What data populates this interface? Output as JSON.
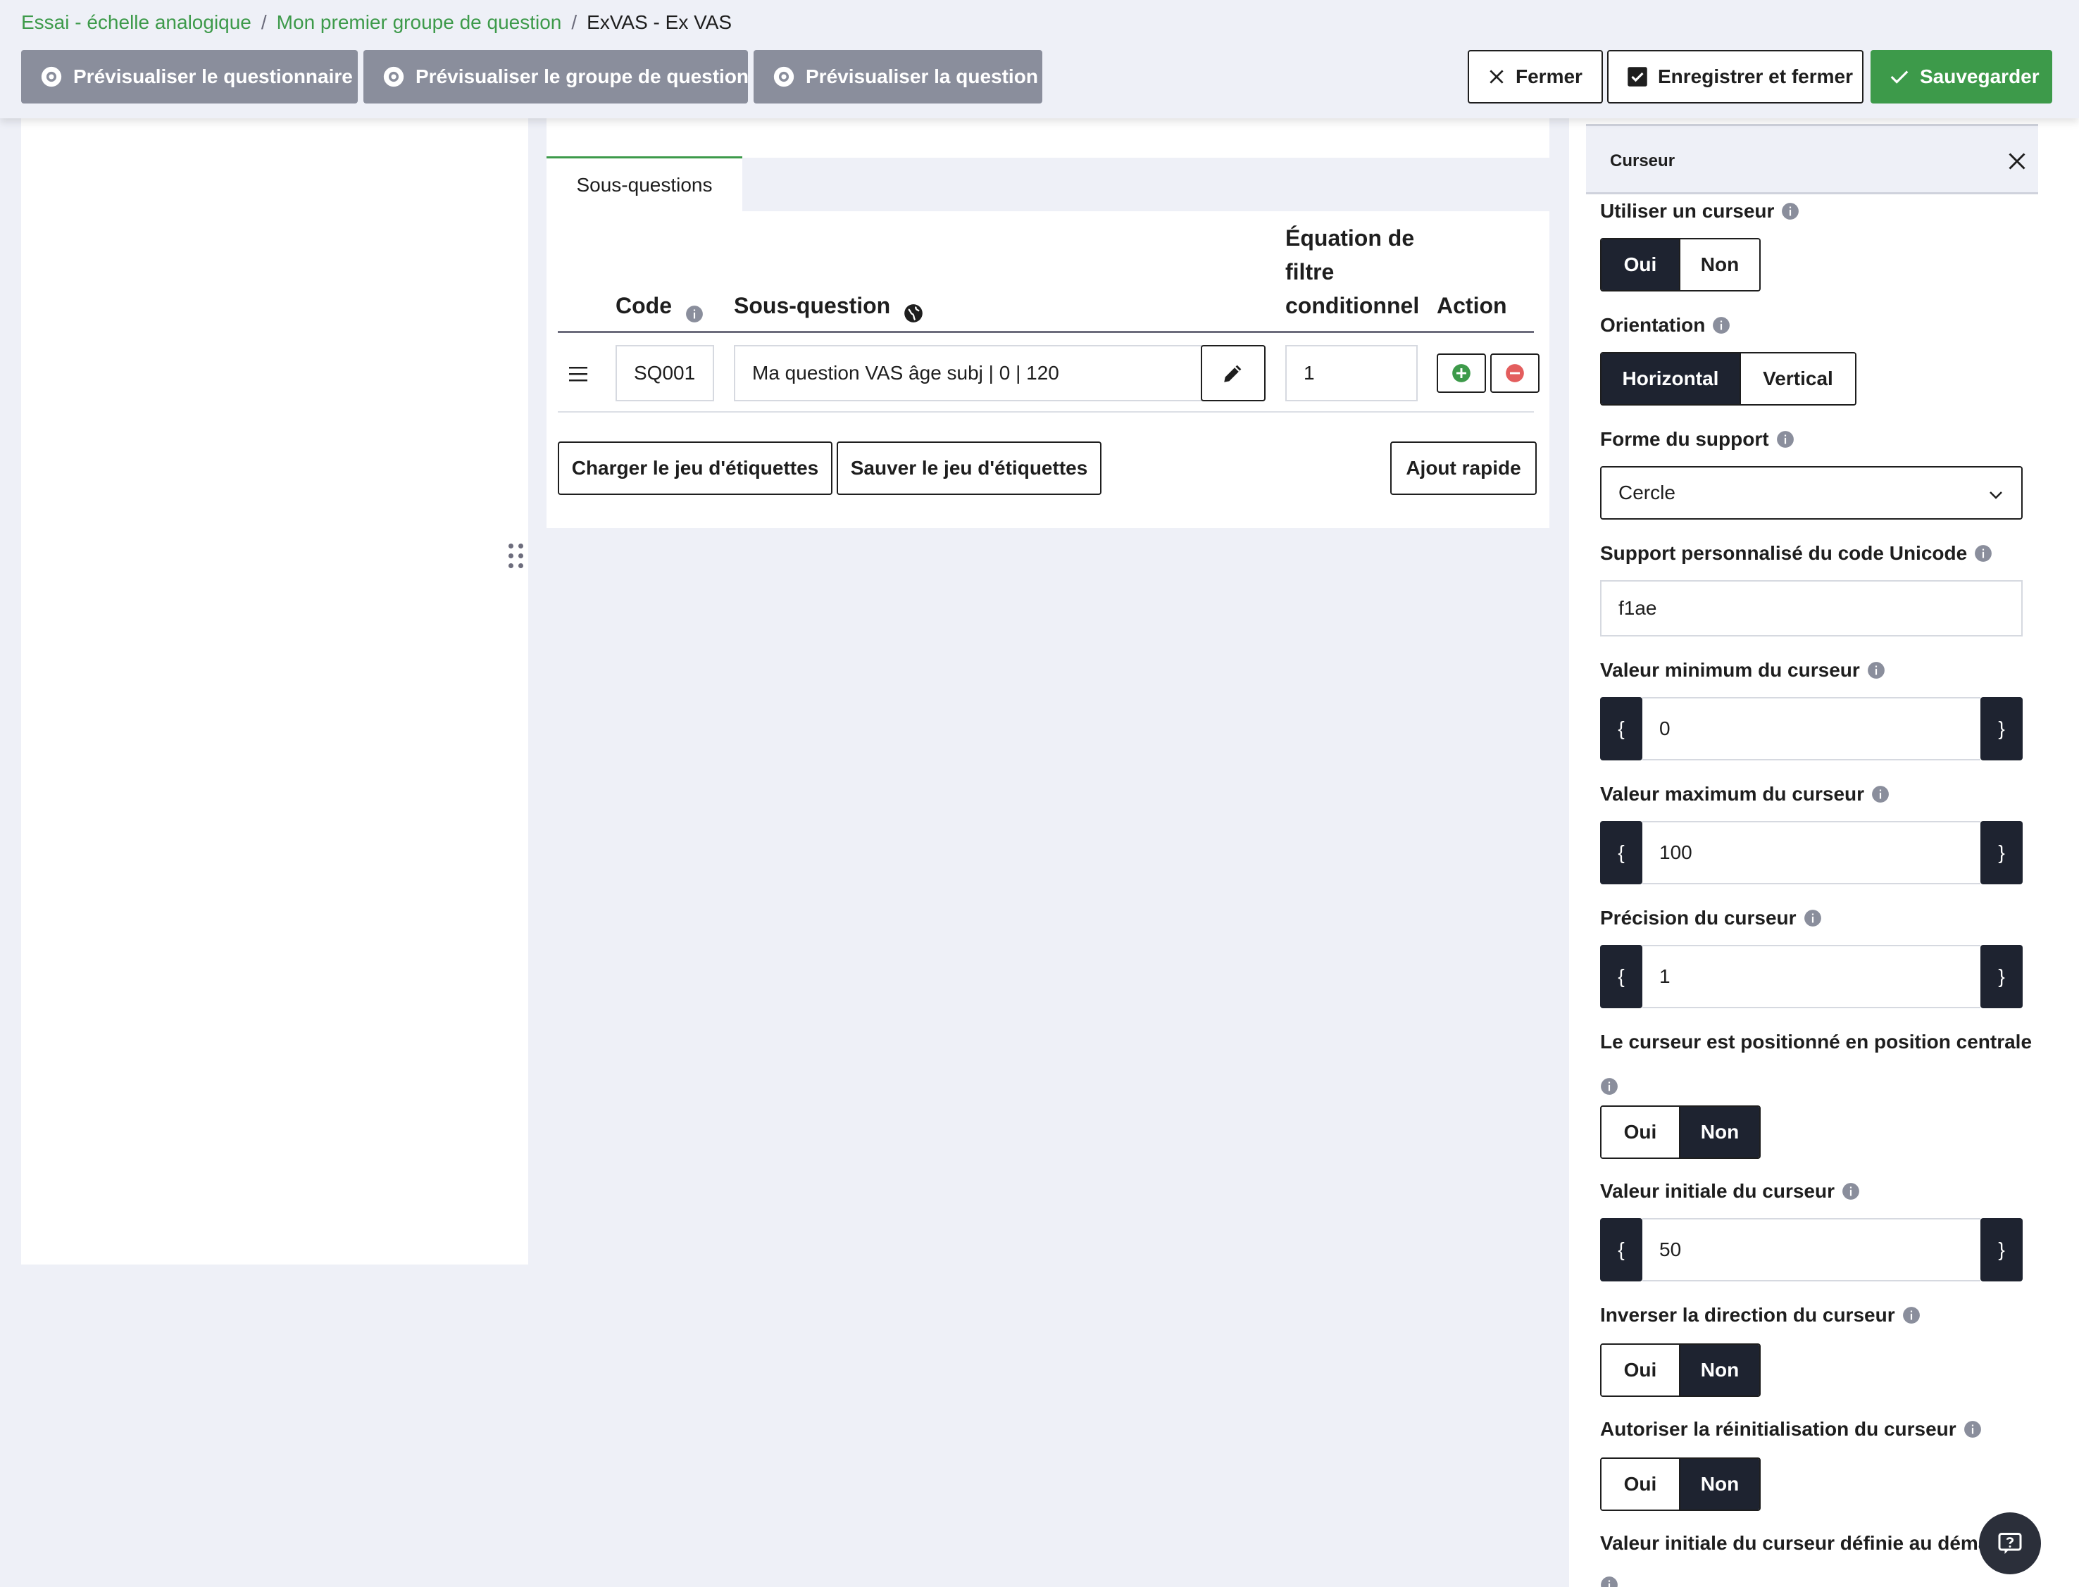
{
  "breadcrumb": {
    "survey": "Essai - échelle analogique",
    "group": "Mon premier groupe de question",
    "current": "ExVAS - Ex VAS",
    "separator": "/"
  },
  "toolbar": {
    "preview_survey": "Prévisualiser le questionnaire",
    "preview_group": "Prévisualiser le groupe de question",
    "preview_question": "Prévisualiser la question",
    "close": "Fermer",
    "save_close": "Enregistrer et fermer",
    "save": "Sauvegarder"
  },
  "center": {
    "tab_label": "Sous-questions",
    "table": {
      "headers": {
        "code": "Code",
        "subquestion": "Sous-question",
        "equation_l1": "Équation de",
        "equation_l2": "filtre",
        "equation_l3": "conditionnel",
        "action": "Action"
      },
      "rows": [
        {
          "code": "SQ001",
          "text": "Ma question VAS âge subj | 0 | 120",
          "equation": "1"
        }
      ]
    },
    "buttons": {
      "load_labels": "Charger le jeu d'étiquettes",
      "save_labels": "Sauver le jeu d'étiquettes",
      "quick_add": "Ajout rapide"
    }
  },
  "right_panel": {
    "title": "Curseur",
    "use_slider": {
      "label": "Utiliser un curseur",
      "options": [
        "Oui",
        "Non"
      ],
      "selected": "Oui"
    },
    "orientation": {
      "label": "Orientation",
      "options": [
        "Horizontal",
        "Vertical"
      ],
      "selected": "Horizontal"
    },
    "support_shape": {
      "label": "Forme du support",
      "value": "Cercle"
    },
    "custom_unicode": {
      "label": "Support personnalisé du code Unicode",
      "value": "f1ae"
    },
    "min_value": {
      "label": "Valeur minimum du curseur",
      "value": "0"
    },
    "max_value": {
      "label": "Valeur maximum du curseur",
      "value": "100"
    },
    "precision": {
      "label": "Précision du curseur",
      "value": "1"
    },
    "centered": {
      "label": "Le curseur est positionné en position centrale",
      "options": [
        "Oui",
        "Non"
      ],
      "selected": "Non"
    },
    "initial_value": {
      "label": "Valeur initiale du curseur",
      "value": "50"
    },
    "invert": {
      "label": "Inverser la direction du curseur",
      "options": [
        "Oui",
        "Non"
      ],
      "selected": "Non"
    },
    "allow_reset": {
      "label": "Autoriser la réinitialisation du curseur",
      "options": [
        "Oui",
        "Non"
      ],
      "selected": "Non"
    },
    "initial_set_label": "Valeur initiale du curseur définie au démar",
    "brace_open": "{",
    "brace_close": "}"
  },
  "colors": {
    "accent_green": "#3d9a4a",
    "dark": "#1e2330",
    "grey_button": "#8a8e9c",
    "background": "#eef0f7"
  },
  "icons": [
    "eye-icon",
    "close-icon",
    "checkbox-checked-icon",
    "check-icon",
    "info-icon",
    "globe-icon",
    "pencil-icon",
    "plus-circle-icon",
    "minus-circle-icon",
    "hamburger-icon",
    "drag-handle-icon",
    "chevron-down-icon",
    "chat-help-icon"
  ]
}
